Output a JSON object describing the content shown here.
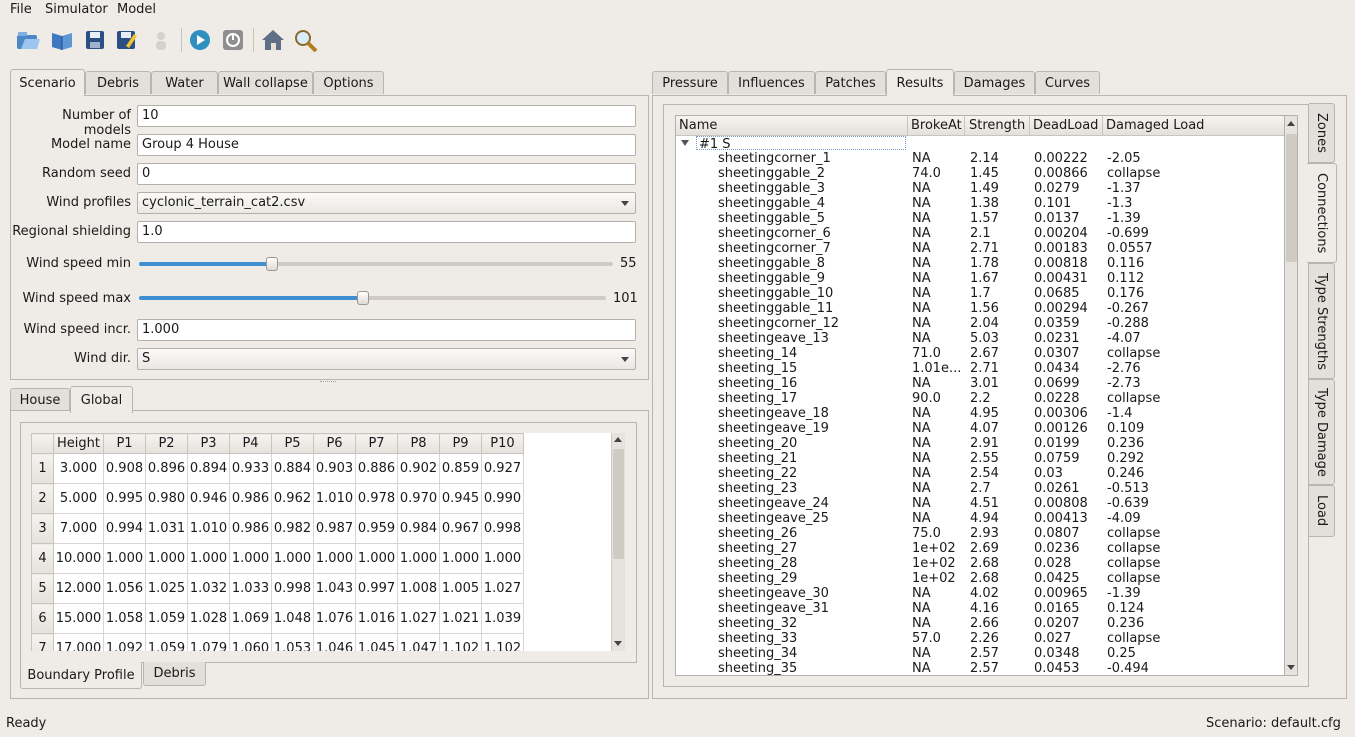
{
  "menu": [
    "File",
    "Simulator",
    "Model"
  ],
  "toolbar_icons": [
    "open-folder-icon",
    "open-book-icon",
    "save-icon",
    "save-as-icon",
    "user-icon",
    "run-icon",
    "stop-icon",
    "home-icon",
    "search-icon"
  ],
  "left_tabs": [
    "Scenario",
    "Debris",
    "Water",
    "Wall collapse",
    "Options"
  ],
  "scenario": {
    "num_models_label": "Number of models",
    "num_models": "10",
    "model_name_label": "Model name",
    "model_name": "Group 4 House",
    "random_seed_label": "Random seed",
    "random_seed": "0",
    "wind_profiles_label": "Wind profiles",
    "wind_profiles": "cyclonic_terrain_cat2.csv",
    "regional_shielding_label": "Regional shielding",
    "regional_shielding": "1.0",
    "wind_min_label": "Wind speed min",
    "wind_min": "55",
    "wind_min_fraction": 0.28,
    "wind_max_label": "Wind speed max",
    "wind_max": "101",
    "wind_max_fraction": 0.48,
    "wind_incr_label": "Wind speed incr.",
    "wind_incr": "1.000",
    "wind_dir_label": "Wind dir.",
    "wind_dir": "S"
  },
  "lower_tabs": [
    "House",
    "Global"
  ],
  "global_table": {
    "headers": [
      "Height",
      "P1",
      "P2",
      "P3",
      "P4",
      "P5",
      "P6",
      "P7",
      "P8",
      "P9",
      "P10"
    ],
    "rows": [
      [
        "1",
        "3.000",
        "0.908",
        "0.896",
        "0.894",
        "0.933",
        "0.884",
        "0.903",
        "0.886",
        "0.902",
        "0.859",
        "0.927"
      ],
      [
        "2",
        "5.000",
        "0.995",
        "0.980",
        "0.946",
        "0.986",
        "0.962",
        "1.010",
        "0.978",
        "0.970",
        "0.945",
        "0.990"
      ],
      [
        "3",
        "7.000",
        "0.994",
        "1.031",
        "1.010",
        "0.986",
        "0.982",
        "0.987",
        "0.959",
        "0.984",
        "0.967",
        "0.998"
      ],
      [
        "4",
        "10.000",
        "1.000",
        "1.000",
        "1.000",
        "1.000",
        "1.000",
        "1.000",
        "1.000",
        "1.000",
        "1.000",
        "1.000"
      ],
      [
        "5",
        "12.000",
        "1.056",
        "1.025",
        "1.032",
        "1.033",
        "0.998",
        "1.043",
        "0.997",
        "1.008",
        "1.005",
        "1.027"
      ],
      [
        "6",
        "15.000",
        "1.058",
        "1.059",
        "1.028",
        "1.069",
        "1.048",
        "1.076",
        "1.016",
        "1.027",
        "1.021",
        "1.039"
      ],
      [
        "7",
        "17.000",
        "1.092",
        "1.059",
        "1.079",
        "1.060",
        "1.053",
        "1.046",
        "1.045",
        "1.047",
        "1.102",
        "1.102"
      ]
    ]
  },
  "bottom_tabs": [
    "Boundary Profile",
    "Debris"
  ],
  "right_tabs": [
    "Pressure",
    "Influences",
    "Patches",
    "Results",
    "Damages",
    "Curves"
  ],
  "side_tabs": [
    "Zones",
    "Connections",
    "Type Strengths",
    "Type Damage",
    "Load"
  ],
  "results": {
    "headers": [
      "Name",
      "BrokeAt",
      "Strength",
      "DeadLoad",
      "Damaged Load"
    ],
    "group": "#1 S",
    "rows": [
      [
        "sheetingcorner_1",
        "NA",
        "2.14",
        "0.00222",
        "-2.05"
      ],
      [
        "sheetinggable_2",
        "74.0",
        "1.45",
        "0.00866",
        "collapse"
      ],
      [
        "sheetinggable_3",
        "NA",
        "1.49",
        "0.0279",
        "-1.37"
      ],
      [
        "sheetinggable_4",
        "NA",
        "1.38",
        "0.101",
        "-1.3"
      ],
      [
        "sheetinggable_5",
        "NA",
        "1.57",
        "0.0137",
        "-1.39"
      ],
      [
        "sheetingcorner_6",
        "NA",
        "2.1",
        "0.00204",
        "-0.699"
      ],
      [
        "sheetingcorner_7",
        "NA",
        "2.71",
        "0.00183",
        "0.0557"
      ],
      [
        "sheetinggable_8",
        "NA",
        "1.78",
        "0.00818",
        "0.116"
      ],
      [
        "sheetinggable_9",
        "NA",
        "1.67",
        "0.00431",
        "0.112"
      ],
      [
        "sheetinggable_10",
        "NA",
        "1.7",
        "0.0685",
        "0.176"
      ],
      [
        "sheetinggable_11",
        "NA",
        "1.56",
        "0.00294",
        "-0.267"
      ],
      [
        "sheetingcorner_12",
        "NA",
        "2.04",
        "0.0359",
        "-0.288"
      ],
      [
        "sheetingeave_13",
        "NA",
        "5.03",
        "0.0231",
        "-4.07"
      ],
      [
        "sheeting_14",
        "71.0",
        "2.67",
        "0.0307",
        "collapse"
      ],
      [
        "sheeting_15",
        "1.01e...",
        "2.71",
        "0.0434",
        "-2.76"
      ],
      [
        "sheeting_16",
        "NA",
        "3.01",
        "0.0699",
        "-2.73"
      ],
      [
        "sheeting_17",
        "90.0",
        "2.2",
        "0.0228",
        "collapse"
      ],
      [
        "sheetingeave_18",
        "NA",
        "4.95",
        "0.00306",
        "-1.4"
      ],
      [
        "sheetingeave_19",
        "NA",
        "4.07",
        "0.00126",
        "0.109"
      ],
      [
        "sheeting_20",
        "NA",
        "2.91",
        "0.0199",
        "0.236"
      ],
      [
        "sheeting_21",
        "NA",
        "2.55",
        "0.0759",
        "0.292"
      ],
      [
        "sheeting_22",
        "NA",
        "2.54",
        "0.03",
        "0.246"
      ],
      [
        "sheeting_23",
        "NA",
        "2.7",
        "0.0261",
        "-0.513"
      ],
      [
        "sheetingeave_24",
        "NA",
        "4.51",
        "0.00808",
        "-0.639"
      ],
      [
        "sheetingeave_25",
        "NA",
        "4.94",
        "0.00413",
        "-4.09"
      ],
      [
        "sheeting_26",
        "75.0",
        "2.93",
        "0.0807",
        "collapse"
      ],
      [
        "sheeting_27",
        "1e+02",
        "2.69",
        "0.0236",
        "collapse"
      ],
      [
        "sheeting_28",
        "1e+02",
        "2.68",
        "0.028",
        "collapse"
      ],
      [
        "sheeting_29",
        "1e+02",
        "2.68",
        "0.0425",
        "collapse"
      ],
      [
        "sheetingeave_30",
        "NA",
        "4.02",
        "0.00965",
        "-1.39"
      ],
      [
        "sheetingeave_31",
        "NA",
        "4.16",
        "0.0165",
        "0.124"
      ],
      [
        "sheeting_32",
        "NA",
        "2.66",
        "0.0207",
        "0.236"
      ],
      [
        "sheeting_33",
        "57.0",
        "2.26",
        "0.027",
        "collapse"
      ],
      [
        "sheeting_34",
        "NA",
        "2.57",
        "0.0348",
        "0.25"
      ],
      [
        "sheeting_35",
        "NA",
        "2.57",
        "0.0453",
        "-0.494"
      ]
    ]
  },
  "status": {
    "left": "Ready",
    "right": "Scenario: default.cfg"
  }
}
